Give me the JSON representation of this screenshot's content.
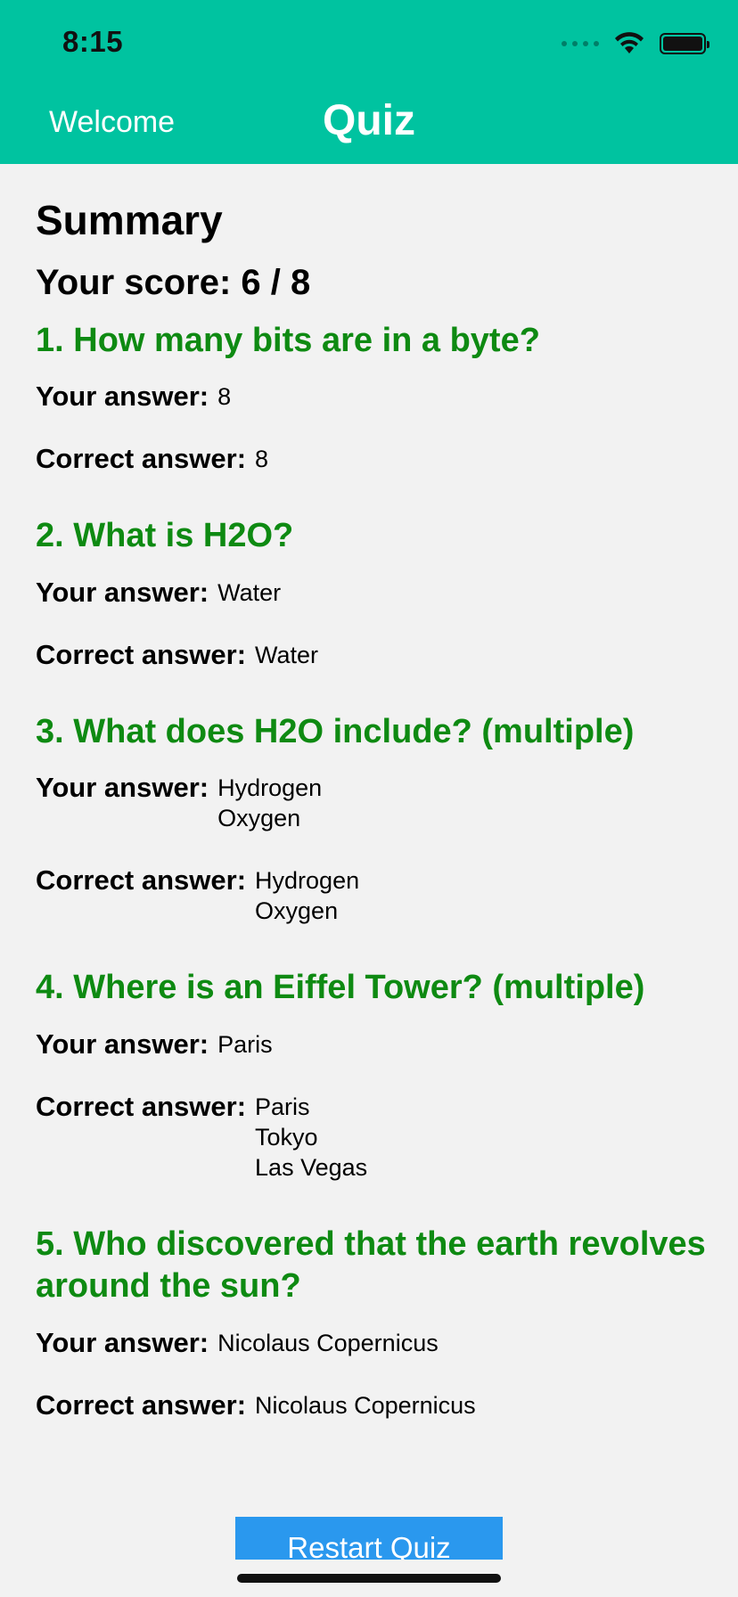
{
  "status_bar": {
    "time": "8:15"
  },
  "nav": {
    "back_label": "Welcome",
    "title": "Quiz"
  },
  "summary": {
    "title": "Summary",
    "score_text": "Your score: 6 / 8"
  },
  "labels": {
    "your_answer": "Your answer:",
    "correct_answer": "Correct answer:"
  },
  "questions": [
    {
      "title": "1. How many bits are in a byte?",
      "your_answer": [
        "8"
      ],
      "correct_answer": [
        "8"
      ]
    },
    {
      "title": "2. What is H2O?",
      "your_answer": [
        "Water"
      ],
      "correct_answer": [
        "Water"
      ]
    },
    {
      "title": "3. What does H2O include? (multiple)",
      "your_answer": [
        "Hydrogen",
        "Oxygen"
      ],
      "correct_answer": [
        "Hydrogen",
        "Oxygen"
      ]
    },
    {
      "title": "4. Where is an Eiffel Tower? (multiple)",
      "your_answer": [
        "Paris"
      ],
      "correct_answer": [
        "Paris",
        "Tokyo",
        "Las Vegas"
      ]
    },
    {
      "title": "5. Who discovered that the earth revolves around the sun?",
      "your_answer": [
        "Nicolaus Copernicus"
      ],
      "correct_answer": [
        "Nicolaus Copernicus"
      ]
    }
  ],
  "restart_button": {
    "label": "Restart Quiz"
  },
  "colors": {
    "header_bg": "#00c3a0",
    "question_title": "#0e8a12",
    "button_bg": "#2a98ee",
    "page_bg": "#f2f2f2"
  }
}
